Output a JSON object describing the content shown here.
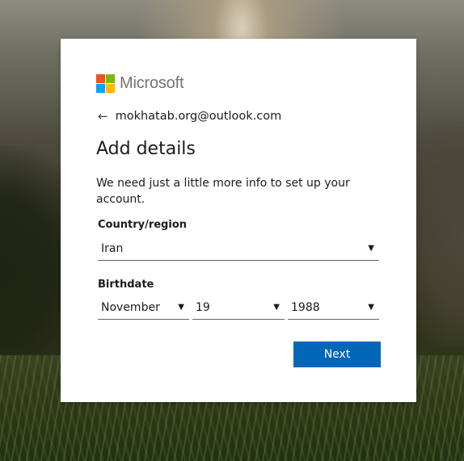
{
  "brand": {
    "name": "Microsoft",
    "logo_colors": [
      "#f25022",
      "#7fba00",
      "#00a4ef",
      "#ffb900"
    ],
    "text_color": "#737373"
  },
  "identity": {
    "back_icon": "back-arrow-icon",
    "email": "mokhatab.org@outlook.com"
  },
  "page": {
    "title": "Add details",
    "description": "We need just a little more info to set up your account."
  },
  "country": {
    "label": "Country/region",
    "value": "Iran"
  },
  "birthdate": {
    "label": "Birthdate",
    "month": "November",
    "day": "19",
    "year": "1988"
  },
  "actions": {
    "next_label": "Next",
    "accent_color": "#0067b8"
  }
}
